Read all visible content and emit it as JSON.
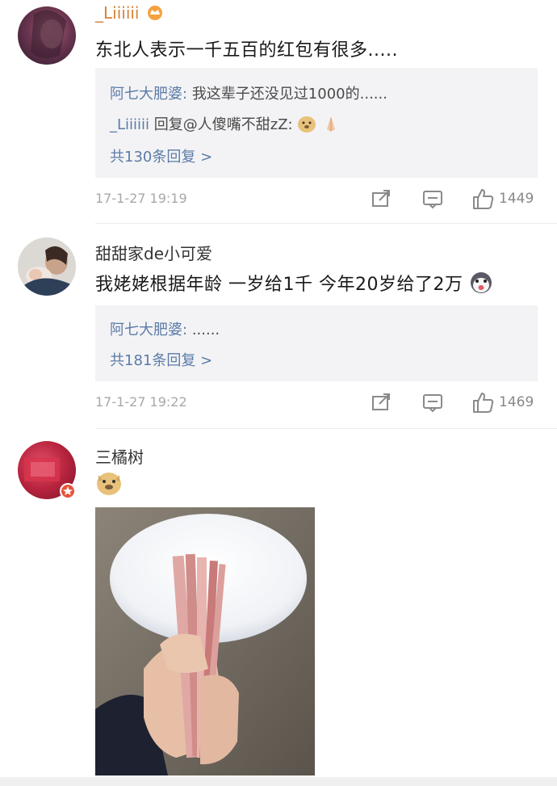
{
  "comments": [
    {
      "username": "_Liiiiii",
      "text": "东北人表示一千五百的红包有很多.....",
      "replies": [
        {
          "user": "阿七大肥婆:",
          "text": "我这辈子还没见过1000的......"
        },
        {
          "user": "_Liiiiii",
          "text": "回复@人傻嘴不甜zZ:"
        }
      ],
      "more_replies": "共130条回复 >",
      "timestamp": "17-1-27 19:19",
      "likes": "1449"
    },
    {
      "username": "甜甜家de小可爱",
      "text": "我姥姥根据年龄 一岁给1千 今年20岁给了2万",
      "replies": [
        {
          "user": "阿七大肥婆:",
          "text": "......"
        }
      ],
      "more_replies": "共181条回复 >",
      "timestamp": "17-1-27 19:22",
      "likes": "1469"
    },
    {
      "username": "三橘树"
    }
  ],
  "icons": {
    "share": "share-icon",
    "comment": "comment-icon",
    "like": "thumbs-up-icon"
  },
  "colors": {
    "link_blue": "#5b7ba8",
    "reply_bg": "#f3f3f5",
    "meta_gray": "#a8a8a8"
  }
}
